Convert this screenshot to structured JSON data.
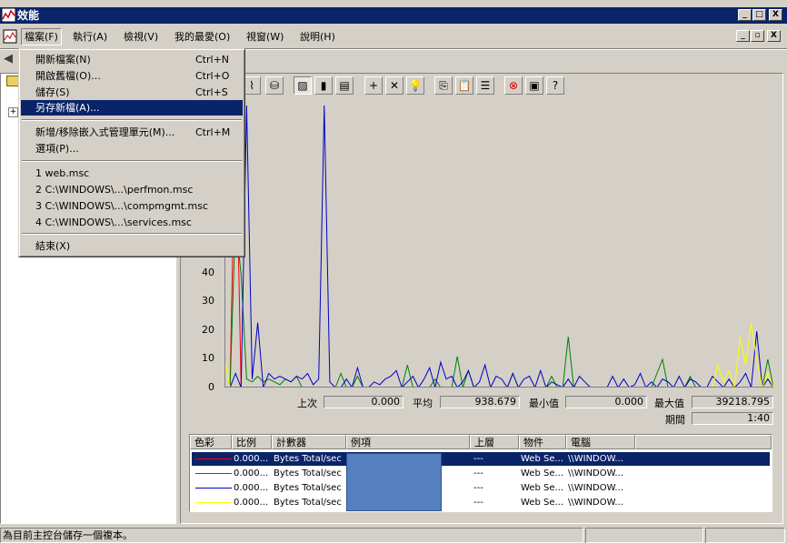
{
  "window": {
    "title": "效能",
    "minimize": "_",
    "maximize": "□",
    "close": "X"
  },
  "menubar": {
    "items": [
      "檔案(F)",
      "執行(A)",
      "檢視(V)",
      "我的最愛(O)",
      "視窗(W)",
      "說明(H)"
    ],
    "mdi_minimize": "_",
    "mdi_restore": "▫",
    "mdi_close": "X"
  },
  "file_menu": {
    "items": [
      {
        "label": "開新檔案(N)",
        "shortcut": "Ctrl+N"
      },
      {
        "label": "開啟舊檔(O)...",
        "shortcut": "Ctrl+O"
      },
      {
        "label": "儲存(S)",
        "shortcut": "Ctrl+S"
      },
      {
        "label": "另存新檔(A)...",
        "shortcut": ""
      },
      {
        "label": "新增/移除嵌入式管理單元(M)...",
        "shortcut": "Ctrl+M"
      },
      {
        "label": "選項(P)...",
        "shortcut": ""
      },
      {
        "label": "1 web.msc",
        "shortcut": ""
      },
      {
        "label": "2 C:\\WINDOWS\\...\\perfmon.msc",
        "shortcut": ""
      },
      {
        "label": "3 C:\\WINDOWS\\...\\compmgmt.msc",
        "shortcut": ""
      },
      {
        "label": "4 C:\\WINDOWS\\...\\services.msc",
        "shortcut": ""
      },
      {
        "label": "結束(X)",
        "shortcut": ""
      }
    ],
    "highlighted_index": 3
  },
  "toolbar": {
    "icons": [
      "histogram-icon",
      "database-icon",
      "graph-view-icon",
      "histogram-view-icon",
      "report-view-icon",
      "add-counter-icon",
      "delete-counter-icon",
      "highlight-icon",
      "copy-properties-icon",
      "paste-counter-icon",
      "properties-icon",
      "freeze-display-icon",
      "update-data-icon",
      "help-icon"
    ],
    "glyphs": [
      "⌇",
      "⛁",
      "▨",
      "▮",
      "▤",
      "+",
      "✕",
      "💡",
      "⎘",
      "📋",
      "☰",
      "⊗",
      "▣",
      "?"
    ]
  },
  "chart_data": {
    "type": "line",
    "y_ticks": [
      "0",
      "10",
      "20",
      "30",
      "40"
    ],
    "ylim": [
      0,
      100
    ],
    "series": [
      {
        "color": "#ff0000",
        "values": [
          0,
          0,
          100,
          0,
          0,
          0,
          0,
          0,
          0,
          0,
          0,
          0,
          0,
          0,
          0,
          0,
          0,
          0,
          0,
          0,
          0,
          0,
          0,
          0,
          0,
          0,
          0,
          0,
          0,
          0,
          0,
          0,
          0,
          0,
          0,
          0,
          0,
          0,
          0,
          0,
          0,
          0,
          0,
          0,
          0,
          0,
          0,
          0,
          0,
          0,
          0,
          0,
          0,
          0,
          0,
          0,
          0,
          0,
          0,
          0,
          0,
          0,
          0,
          0,
          0,
          0,
          0,
          0,
          0,
          0,
          0,
          0,
          0,
          0,
          0,
          0,
          0,
          0,
          0,
          0,
          0,
          0,
          0,
          0,
          0,
          0,
          0,
          0,
          0,
          0,
          0,
          0,
          0,
          0,
          0,
          0,
          0,
          0,
          0,
          0
        ]
      },
      {
        "color": "#008000",
        "values": [
          0,
          0,
          60,
          40,
          3,
          2,
          4,
          2,
          3,
          2,
          1,
          3,
          2,
          4,
          0,
          0,
          0,
          0,
          0,
          0,
          0,
          5,
          0,
          0,
          4,
          0,
          0,
          0,
          0,
          0,
          0,
          0,
          0,
          8,
          0,
          0,
          0,
          0,
          3,
          0,
          0,
          0,
          11,
          0,
          6,
          0,
          0,
          0,
          0,
          0,
          0,
          0,
          5,
          0,
          0,
          0,
          0,
          0,
          0,
          4,
          0,
          0,
          18,
          0,
          0,
          0,
          0,
          0,
          0,
          0,
          0,
          0,
          0,
          0,
          0,
          0,
          0,
          0,
          5,
          10,
          0,
          0,
          0,
          0,
          4,
          0,
          0,
          0,
          0,
          0,
          0,
          0,
          0,
          0,
          0,
          0,
          0,
          0,
          10,
          0
        ]
      },
      {
        "color": "#0000c0",
        "values": [
          0,
          0,
          5,
          0,
          100,
          3,
          23,
          0,
          5,
          3,
          4,
          3,
          2,
          4,
          3,
          5,
          1,
          3,
          100,
          2,
          0,
          0,
          3,
          0,
          7,
          0,
          0,
          2,
          1,
          3,
          4,
          6,
          0,
          2,
          4,
          0,
          3,
          7,
          0,
          9,
          3,
          4,
          0,
          2,
          6,
          0,
          2,
          8,
          0,
          4,
          3,
          0,
          5,
          0,
          3,
          4,
          0,
          6,
          0,
          2,
          1,
          0,
          3,
          0,
          4,
          2,
          0,
          0,
          0,
          0,
          4,
          0,
          3,
          0,
          1,
          5,
          0,
          2,
          0,
          3,
          2,
          0,
          4,
          0,
          3,
          2,
          0,
          0,
          4,
          2,
          0,
          3,
          0,
          2,
          5,
          0,
          20,
          0,
          3,
          0
        ]
      },
      {
        "color": "#ffff00",
        "values": [
          10,
          0,
          0,
          0,
          0,
          0,
          0,
          0,
          0,
          0,
          0,
          0,
          0,
          0,
          0,
          0,
          0,
          0,
          0,
          0,
          0,
          0,
          0,
          0,
          0,
          0,
          0,
          0,
          0,
          0,
          0,
          0,
          0,
          0,
          0,
          0,
          0,
          0,
          0,
          0,
          0,
          0,
          0,
          0,
          0,
          0,
          0,
          0,
          0,
          0,
          0,
          0,
          0,
          0,
          0,
          0,
          0,
          0,
          0,
          0,
          0,
          0,
          0,
          0,
          0,
          0,
          0,
          0,
          0,
          0,
          0,
          0,
          0,
          0,
          0,
          0,
          0,
          0,
          0,
          0,
          0,
          0,
          0,
          0,
          0,
          0,
          0,
          0,
          0,
          8,
          2,
          6,
          0,
          18,
          8,
          23,
          10,
          0,
          5,
          0
        ]
      }
    ]
  },
  "stats": {
    "last_label": "上次",
    "last_value": "0.000",
    "avg_label": "平均",
    "avg_value": "938.679",
    "min_label": "最小值",
    "min_value": "0.000",
    "max_label": "最大值",
    "max_value": "39218.795",
    "duration_label": "期間",
    "duration_value": "1:40"
  },
  "counter_table": {
    "headers": [
      "色彩",
      "比例",
      "計數器",
      "例項",
      "上層",
      "物件",
      "電腦"
    ],
    "rows": [
      {
        "color": "#ff0000",
        "scale": "0.000...",
        "counter": "Bytes Total/sec",
        "parent": "---",
        "object": "Web Se...",
        "computer": "\\\\WINDOW..."
      },
      {
        "color": "#008000",
        "scale": "0.000...",
        "counter": "Bytes Total/sec",
        "parent": "---",
        "object": "Web Se...",
        "computer": "\\\\WINDOW..."
      },
      {
        "color": "#0000c0",
        "scale": "0.000...",
        "counter": "Bytes Total/sec",
        "parent": "---",
        "object": "Web Se...",
        "computer": "\\\\WINDOW..."
      },
      {
        "color": "#ffff00",
        "scale": "0.000...",
        "counter": "Bytes Total/sec",
        "parent": "---",
        "object": "Web Se...",
        "computer": "\\\\WINDOW..."
      }
    ]
  },
  "statusbar": {
    "text": "為目前主控台儲存一個複本。"
  }
}
